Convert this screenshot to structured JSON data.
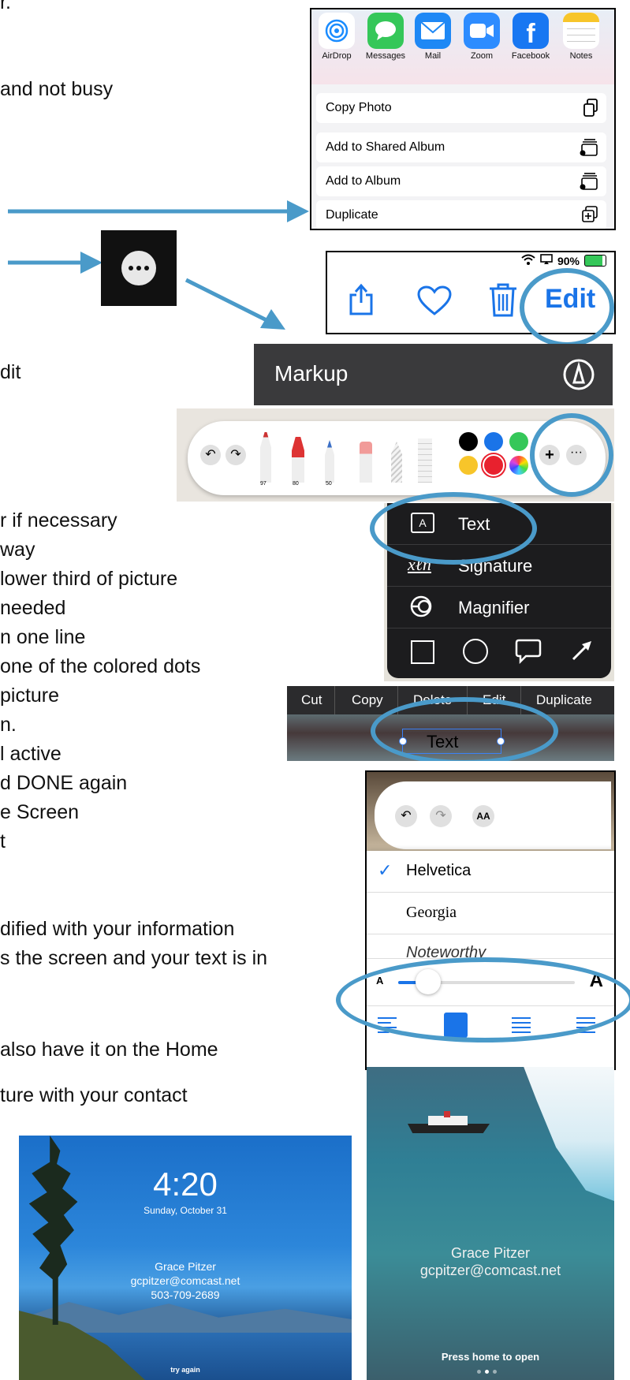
{
  "instructions": [
    {
      "id": "i1",
      "text": "r."
    },
    {
      "id": "i2",
      "text": "and not busy"
    },
    {
      "id": "i3",
      "text": "dit"
    },
    {
      "id": "i4",
      "text": "r if necessary"
    },
    {
      "id": "i5",
      "text": "way"
    },
    {
      "id": "i6",
      "text": "lower third of picture"
    },
    {
      "id": "i7",
      "text": "needed"
    },
    {
      "id": "i8",
      "text": "n one line"
    },
    {
      "id": "i9",
      "text": "one of the colored dots"
    },
    {
      "id": "i10",
      "text": "picture"
    },
    {
      "id": "i11",
      "text": "n."
    },
    {
      "id": "i12",
      "text": "l active"
    },
    {
      "id": "i13",
      "text": "d DONE again"
    },
    {
      "id": "i14",
      "text": "e Screen"
    },
    {
      "id": "i15",
      "text": "t"
    },
    {
      "id": "i16",
      "text": "dified with your information"
    },
    {
      "id": "i17",
      "text": "s the screen and your text is in"
    },
    {
      "id": "i18",
      "text": "also have it on the Home"
    },
    {
      "id": "i19",
      "text": "ture with your contact"
    }
  ],
  "share_sheet": {
    "apps": [
      "AirDrop",
      "Messages",
      "Mail",
      "Zoom",
      "Facebook",
      "Notes"
    ],
    "actions": [
      "Copy Photo",
      "Add to Shared Album",
      "Add to Album",
      "Duplicate"
    ]
  },
  "top_bar": {
    "status": "90%",
    "edit_label": "Edit"
  },
  "markup": {
    "title": "Markup"
  },
  "tools": {
    "pen_labels": [
      "97",
      "80",
      "50"
    ]
  },
  "menu": {
    "items": [
      "Text",
      "Signature",
      "Magnifier"
    ]
  },
  "context": {
    "items": [
      "Cut",
      "Copy",
      "Delete",
      "Edit",
      "Duplicate"
    ],
    "text_box": "Text"
  },
  "font_panel": {
    "fonts": [
      "Helvetica",
      "Georgia",
      "Noteworthy"
    ],
    "size_small": "A",
    "size_large": "A",
    "size_level": 0.17
  },
  "lock_screen": {
    "time": "4:20",
    "date": "Sunday, October 31",
    "name": "Grace Pitzer",
    "email": "gcpitzer@comcast.net",
    "phone": "503-709-2689",
    "footer": "try again"
  },
  "iceberg_screen": {
    "name": "Grace Pitzer",
    "email": "gcpitzer@comcast.net",
    "footer": "Press home to open"
  },
  "colors": {
    "annotation_blue": "#4a9ac9",
    "ios_blue": "#1a74e8"
  }
}
